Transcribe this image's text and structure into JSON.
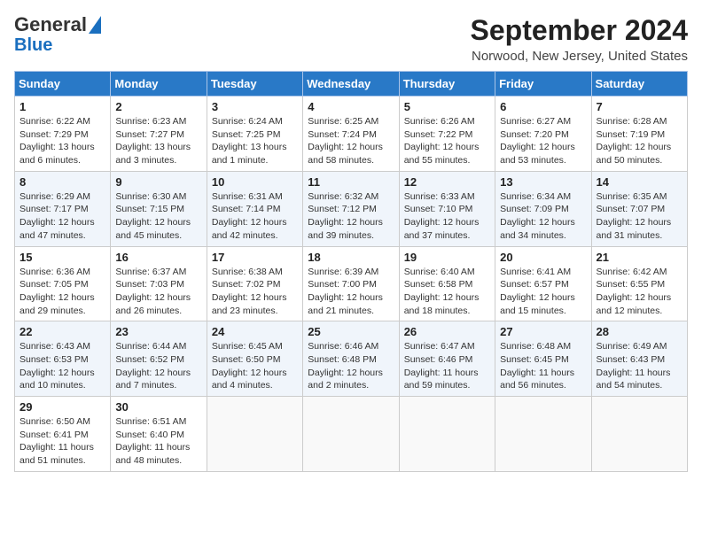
{
  "logo": {
    "line1": "General",
    "line2": "Blue"
  },
  "title": "September 2024",
  "subtitle": "Norwood, New Jersey, United States",
  "days_header": [
    "Sunday",
    "Monday",
    "Tuesday",
    "Wednesday",
    "Thursday",
    "Friday",
    "Saturday"
  ],
  "weeks": [
    [
      {
        "day": "1",
        "info": "Sunrise: 6:22 AM\nSunset: 7:29 PM\nDaylight: 13 hours\nand 6 minutes."
      },
      {
        "day": "2",
        "info": "Sunrise: 6:23 AM\nSunset: 7:27 PM\nDaylight: 13 hours\nand 3 minutes."
      },
      {
        "day": "3",
        "info": "Sunrise: 6:24 AM\nSunset: 7:25 PM\nDaylight: 13 hours\nand 1 minute."
      },
      {
        "day": "4",
        "info": "Sunrise: 6:25 AM\nSunset: 7:24 PM\nDaylight: 12 hours\nand 58 minutes."
      },
      {
        "day": "5",
        "info": "Sunrise: 6:26 AM\nSunset: 7:22 PM\nDaylight: 12 hours\nand 55 minutes."
      },
      {
        "day": "6",
        "info": "Sunrise: 6:27 AM\nSunset: 7:20 PM\nDaylight: 12 hours\nand 53 minutes."
      },
      {
        "day": "7",
        "info": "Sunrise: 6:28 AM\nSunset: 7:19 PM\nDaylight: 12 hours\nand 50 minutes."
      }
    ],
    [
      {
        "day": "8",
        "info": "Sunrise: 6:29 AM\nSunset: 7:17 PM\nDaylight: 12 hours\nand 47 minutes."
      },
      {
        "day": "9",
        "info": "Sunrise: 6:30 AM\nSunset: 7:15 PM\nDaylight: 12 hours\nand 45 minutes."
      },
      {
        "day": "10",
        "info": "Sunrise: 6:31 AM\nSunset: 7:14 PM\nDaylight: 12 hours\nand 42 minutes."
      },
      {
        "day": "11",
        "info": "Sunrise: 6:32 AM\nSunset: 7:12 PM\nDaylight: 12 hours\nand 39 minutes."
      },
      {
        "day": "12",
        "info": "Sunrise: 6:33 AM\nSunset: 7:10 PM\nDaylight: 12 hours\nand 37 minutes."
      },
      {
        "day": "13",
        "info": "Sunrise: 6:34 AM\nSunset: 7:09 PM\nDaylight: 12 hours\nand 34 minutes."
      },
      {
        "day": "14",
        "info": "Sunrise: 6:35 AM\nSunset: 7:07 PM\nDaylight: 12 hours\nand 31 minutes."
      }
    ],
    [
      {
        "day": "15",
        "info": "Sunrise: 6:36 AM\nSunset: 7:05 PM\nDaylight: 12 hours\nand 29 minutes."
      },
      {
        "day": "16",
        "info": "Sunrise: 6:37 AM\nSunset: 7:03 PM\nDaylight: 12 hours\nand 26 minutes."
      },
      {
        "day": "17",
        "info": "Sunrise: 6:38 AM\nSunset: 7:02 PM\nDaylight: 12 hours\nand 23 minutes."
      },
      {
        "day": "18",
        "info": "Sunrise: 6:39 AM\nSunset: 7:00 PM\nDaylight: 12 hours\nand 21 minutes."
      },
      {
        "day": "19",
        "info": "Sunrise: 6:40 AM\nSunset: 6:58 PM\nDaylight: 12 hours\nand 18 minutes."
      },
      {
        "day": "20",
        "info": "Sunrise: 6:41 AM\nSunset: 6:57 PM\nDaylight: 12 hours\nand 15 minutes."
      },
      {
        "day": "21",
        "info": "Sunrise: 6:42 AM\nSunset: 6:55 PM\nDaylight: 12 hours\nand 12 minutes."
      }
    ],
    [
      {
        "day": "22",
        "info": "Sunrise: 6:43 AM\nSunset: 6:53 PM\nDaylight: 12 hours\nand 10 minutes."
      },
      {
        "day": "23",
        "info": "Sunrise: 6:44 AM\nSunset: 6:52 PM\nDaylight: 12 hours\nand 7 minutes."
      },
      {
        "day": "24",
        "info": "Sunrise: 6:45 AM\nSunset: 6:50 PM\nDaylight: 12 hours\nand 4 minutes."
      },
      {
        "day": "25",
        "info": "Sunrise: 6:46 AM\nSunset: 6:48 PM\nDaylight: 12 hours\nand 2 minutes."
      },
      {
        "day": "26",
        "info": "Sunrise: 6:47 AM\nSunset: 6:46 PM\nDaylight: 11 hours\nand 59 minutes."
      },
      {
        "day": "27",
        "info": "Sunrise: 6:48 AM\nSunset: 6:45 PM\nDaylight: 11 hours\nand 56 minutes."
      },
      {
        "day": "28",
        "info": "Sunrise: 6:49 AM\nSunset: 6:43 PM\nDaylight: 11 hours\nand 54 minutes."
      }
    ],
    [
      {
        "day": "29",
        "info": "Sunrise: 6:50 AM\nSunset: 6:41 PM\nDaylight: 11 hours\nand 51 minutes."
      },
      {
        "day": "30",
        "info": "Sunrise: 6:51 AM\nSunset: 6:40 PM\nDaylight: 11 hours\nand 48 minutes."
      },
      {
        "day": "",
        "info": ""
      },
      {
        "day": "",
        "info": ""
      },
      {
        "day": "",
        "info": ""
      },
      {
        "day": "",
        "info": ""
      },
      {
        "day": "",
        "info": ""
      }
    ]
  ]
}
